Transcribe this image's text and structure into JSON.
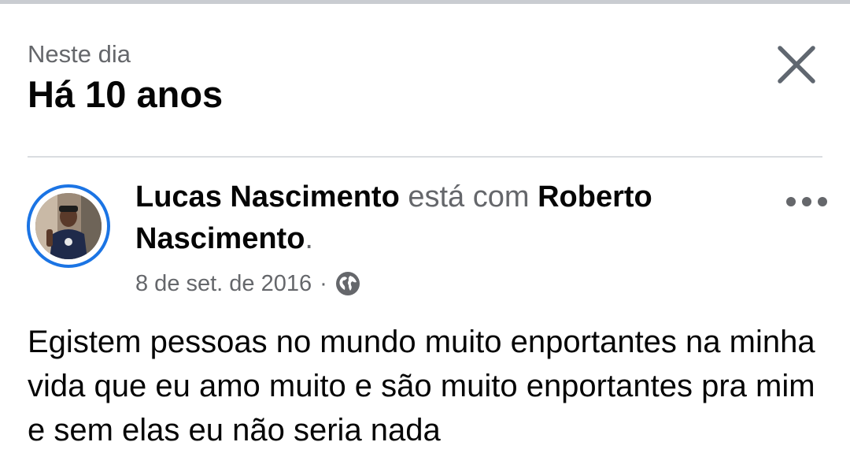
{
  "header": {
    "subtitle": "Neste dia",
    "title": "Há 10 anos"
  },
  "post": {
    "author": "Lucas Nascimento",
    "with_text": " está com ",
    "tagged": "Roberto Nascimento",
    "period": ".",
    "date": "8 de set. de 2016",
    "separator": "·",
    "privacy_icon": "globe-icon",
    "text": "Egistem pessoas no mundo muito enportantes na minha vida que eu amo muito e são muito enportantes pra mim e sem elas eu não seria nada"
  },
  "icons": {
    "close": "close-icon",
    "more": "more-options-icon"
  },
  "colors": {
    "accent": "#1b74e4",
    "secondary_text": "#65676b",
    "primary_text": "#050505",
    "divider": "#dadde1"
  }
}
